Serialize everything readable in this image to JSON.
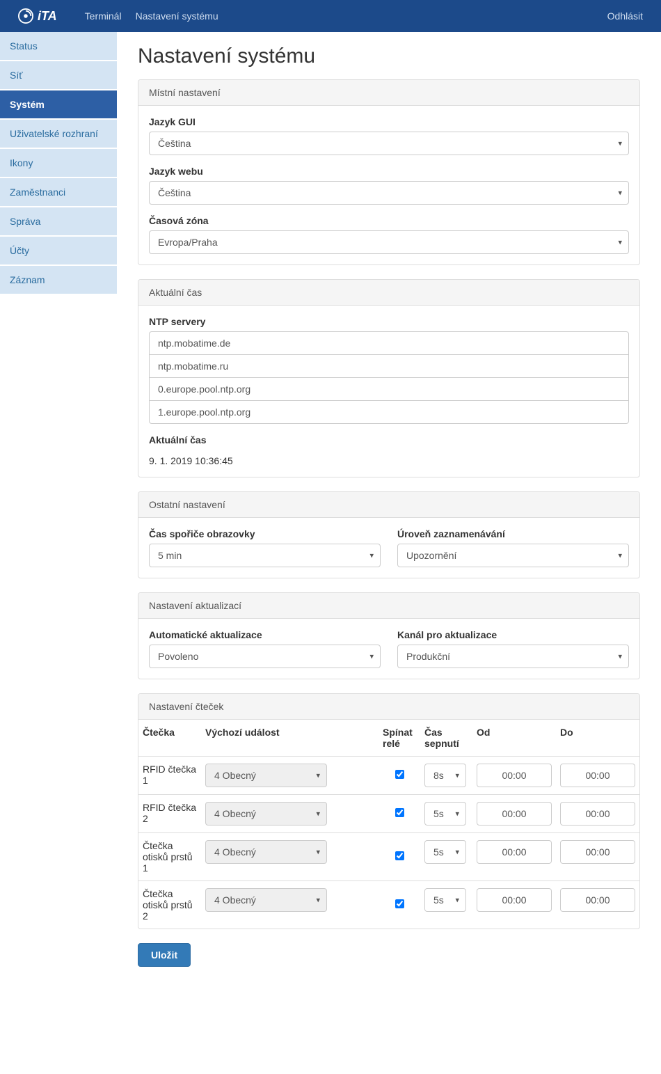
{
  "navbar": {
    "brand_text": "iTA",
    "link_terminal": "Terminál",
    "link_settings": "Nastavení systému",
    "link_logout": "Odhlásit"
  },
  "sidebar": {
    "items": [
      {
        "label": "Status"
      },
      {
        "label": "Síť"
      },
      {
        "label": "Systém"
      },
      {
        "label": "Uživatelské rozhraní"
      },
      {
        "label": "Ikony"
      },
      {
        "label": "Zaměstnanci"
      },
      {
        "label": "Správa"
      },
      {
        "label": "Účty"
      },
      {
        "label": "Záznam"
      }
    ]
  },
  "page": {
    "title": "Nastavení systému"
  },
  "panel_local": {
    "heading": "Místní nastavení",
    "gui_lang_label": "Jazyk GUI",
    "gui_lang_value": "Čeština",
    "web_lang_label": "Jazyk webu",
    "web_lang_value": "Čeština",
    "tz_label": "Časová zóna",
    "tz_value": "Evropa/Praha"
  },
  "panel_time": {
    "heading": "Aktuální čas",
    "ntp_label": "NTP servery",
    "ntp": [
      "ntp.mobatime.de",
      "ntp.mobatime.ru",
      "0.europe.pool.ntp.org",
      "1.europe.pool.ntp.org"
    ],
    "ct_label": "Aktuální čas",
    "ct_value": "9. 1. 2019 10:36:45"
  },
  "panel_other": {
    "heading": "Ostatní nastavení",
    "screensaver_label": "Čas spořiče obrazovky",
    "screensaver_value": "5 min",
    "loglevel_label": "Úroveň zaznamenávání",
    "loglevel_value": "Upozornění"
  },
  "panel_updates": {
    "heading": "Nastavení aktualizací",
    "auto_label": "Automatické aktualizace",
    "auto_value": "Povoleno",
    "channel_label": "Kanál pro aktualizace",
    "channel_value": "Produkční"
  },
  "panel_readers": {
    "heading": "Nastavení čteček",
    "columns": {
      "reader": "Čtečka",
      "event": "Výchozí událost",
      "relay": "Spínat relé",
      "switch_time": "Čas sepnutí",
      "from": "Od",
      "to": "Do"
    },
    "rows": [
      {
        "reader": "RFID čtečka 1",
        "event": "4 Obecný",
        "relay": true,
        "switch_time": "8s",
        "from": "00:00",
        "to": "00:00"
      },
      {
        "reader": "RFID čtečka 2",
        "event": "4 Obecný",
        "relay": true,
        "switch_time": "5s",
        "from": "00:00",
        "to": "00:00"
      },
      {
        "reader": "Čtečka otisků prstů 1",
        "event": "4 Obecný",
        "relay": true,
        "switch_time": "5s",
        "from": "00:00",
        "to": "00:00"
      },
      {
        "reader": "Čtečka otisků prstů 2",
        "event": "4 Obecný",
        "relay": true,
        "switch_time": "5s",
        "from": "00:00",
        "to": "00:00"
      }
    ]
  },
  "save_label": "Uložit"
}
